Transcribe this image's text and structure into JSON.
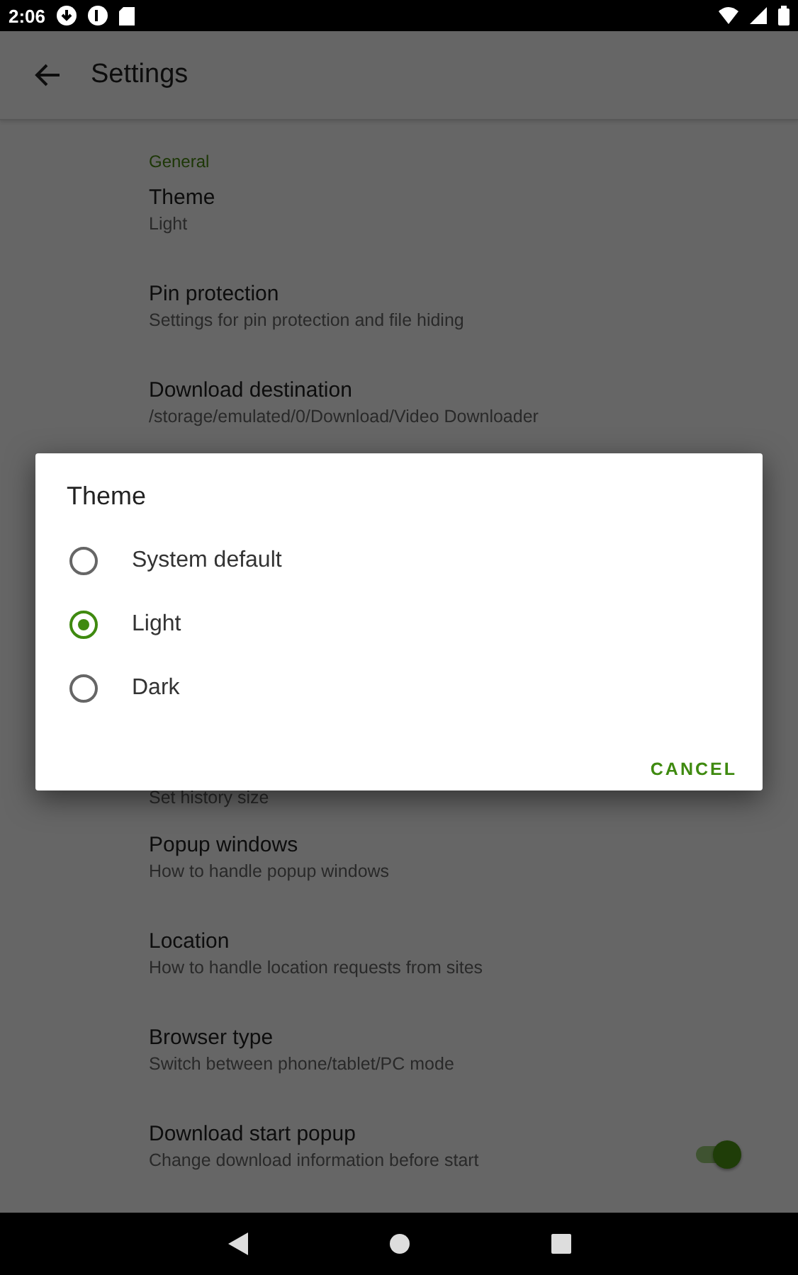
{
  "status_bar": {
    "time": "2:06"
  },
  "app_bar": {
    "title": "Settings"
  },
  "settings": {
    "section": "General",
    "items": [
      {
        "title": "Theme",
        "summary": "Light"
      },
      {
        "title": "Pin protection",
        "summary": "Settings for pin protection and file hiding"
      },
      {
        "title": "Download destination",
        "summary": "/storage/emulated/0/Download/Video Downloader"
      },
      {
        "summary": "Set history size"
      },
      {
        "title": "Popup windows",
        "summary": "How to handle popup windows"
      },
      {
        "title": "Location",
        "summary": "How to handle location requests from sites"
      },
      {
        "title": "Browser type",
        "summary": "Switch between phone/tablet/PC mode"
      },
      {
        "title": "Download start popup",
        "summary": "Change download information before start",
        "kind": "switch",
        "on": true
      }
    ]
  },
  "dialog": {
    "title": "Theme",
    "options": [
      {
        "label": "System default",
        "selected": false
      },
      {
        "label": "Light",
        "selected": true
      },
      {
        "label": "Dark",
        "selected": false
      }
    ],
    "buttons": [
      "CANCEL"
    ]
  }
}
